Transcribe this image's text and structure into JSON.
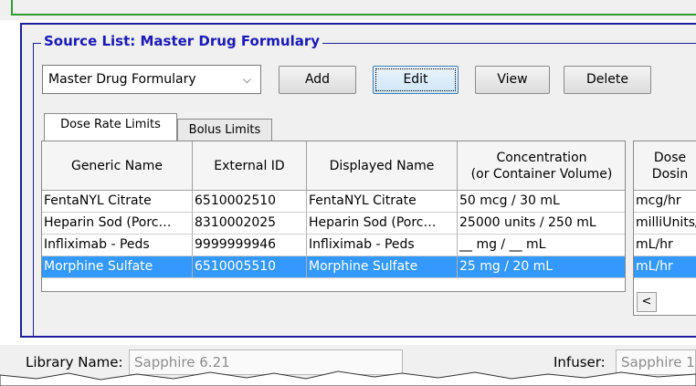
{
  "group_title": "Source List: Master Drug Formulary",
  "source_select": {
    "selected": "Master Drug Formulary"
  },
  "buttons": {
    "add": "Add",
    "edit": "Edit",
    "view": "View",
    "delete": "Delete"
  },
  "tabs": [
    {
      "label": "Dose Rate Limits",
      "active": true
    },
    {
      "label": "Bolus Limits",
      "active": false
    }
  ],
  "table": {
    "columns": [
      "Generic Name",
      "External ID",
      "Displayed Name",
      "Concentration\n(or Container Volume)"
    ],
    "rows": [
      [
        "FentaNYL Citrate",
        "6510002510",
        "FentaNYL Citrate",
        "50 mcg / 30 mL"
      ],
      [
        "Heparin Sod (Porc…",
        "8310002025",
        "Heparin Sod (Porc…",
        "25000 units / 250 mL"
      ],
      [
        "Infliximab - Peds",
        "9999999946",
        "Infliximab - Peds",
        "__ mg / __ mL"
      ],
      [
        "Morphine Sulfate",
        "6510005510",
        "Morphine Sulfate",
        "25 mg / 20 mL"
      ]
    ],
    "selected_row": 3
  },
  "table2": {
    "header": "Dose\nDosin",
    "rows": [
      "mcg/hr",
      "milliUnits/",
      "mL/hr",
      "mL/hr"
    ]
  },
  "footer": {
    "library_label": "Library Name:",
    "library_value": "Sapphire 6.21",
    "infuser_label": "Infuser:",
    "infuser_value": "Sapphire 1"
  },
  "colors": {
    "accent": "#1a1ab8",
    "selection": "#3399ff",
    "border_green": "#2f9d2f"
  }
}
